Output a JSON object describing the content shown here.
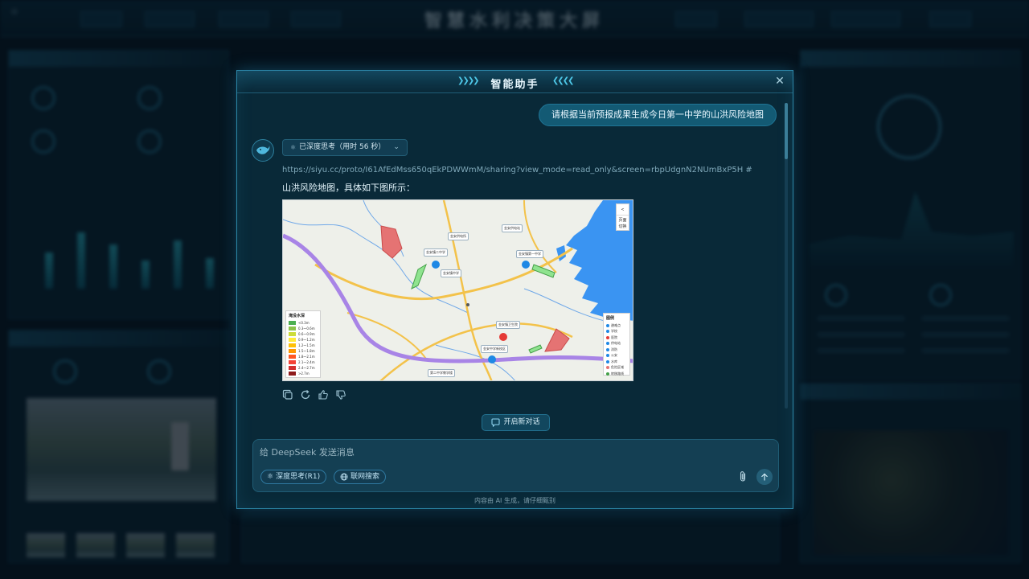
{
  "window": {
    "title": "智能助手"
  },
  "conversation": {
    "user_message": "请根据当前预报成果生成今日第一中学的山洪风险地图",
    "thinking_label": "已深度思考（用时 56 秒）",
    "link": "https://siyu.cc/proto/I61AfEdMss650qEkPDWWmM/sharing?view_mode=read_only&screen=rbpUdgnN2NUmBxP5H #",
    "reply": "山洪风险地图，具体如下图所示："
  },
  "map": {
    "legend_title": "淹没水深",
    "legend": [
      {
        "label": "<0.3m",
        "color": "#4caf50"
      },
      {
        "label": "0.3～0.6m",
        "color": "#8bc34a"
      },
      {
        "label": "0.6～0.9m",
        "color": "#cddc39"
      },
      {
        "label": "0.9～1.2m",
        "color": "#ffeb3b"
      },
      {
        "label": "1.2～1.5m",
        "color": "#ffc107"
      },
      {
        "label": "1.5～1.8m",
        "color": "#ff9800"
      },
      {
        "label": "1.8～2.1m",
        "color": "#ff5722"
      },
      {
        "label": "2.1～2.4m",
        "color": "#f44336"
      },
      {
        "label": "2.4～2.7m",
        "color": "#d32f2f"
      },
      {
        "label": ">2.7m",
        "color": "#8e1b1b"
      }
    ],
    "poi_legend_title": "图例",
    "poi_legend": [
      {
        "label": "避难点",
        "color": "#1e88e5"
      },
      {
        "label": "学校",
        "color": "#1e88e5"
      },
      {
        "label": "医院",
        "color": "#e53935"
      },
      {
        "label": "供电站",
        "color": "#1e88e5"
      },
      {
        "label": "消防",
        "color": "#1e88e5"
      },
      {
        "label": "公安",
        "color": "#1e88e5"
      },
      {
        "label": "水库",
        "color": "#1e88e5"
      },
      {
        "label": "危险区域",
        "color": "#e57373"
      },
      {
        "label": "转移路线",
        "color": "#43a047"
      }
    ],
    "controls": {
      "collapse": "<",
      "label": "页面 切换"
    },
    "labels": [
      "金安镇二中学",
      "金安镇第一中学",
      "金安镇中学",
      "金安镇卫生院",
      "金安供电所",
      "第二中学教学楼",
      "金安中学新校区",
      "金安供电站"
    ]
  },
  "actions": [
    "copy-icon",
    "refresh-icon",
    "thumbs-up-icon",
    "thumbs-down-icon"
  ],
  "new_chat": "开启新对话",
  "input": {
    "placeholder": "给 DeepSeek 发送消息",
    "value": "",
    "deep_think": "深度思考(R1)",
    "web_search": "联网搜索"
  },
  "footer": {
    "disclaimer": "内容由 AI 生成，请仔细甄别"
  },
  "background": {
    "title": "智慧水利决策大屏"
  },
  "colors": {
    "modal_bg": "#092a3a",
    "accent": "#2c86a8",
    "bubble": "#135a74"
  }
}
